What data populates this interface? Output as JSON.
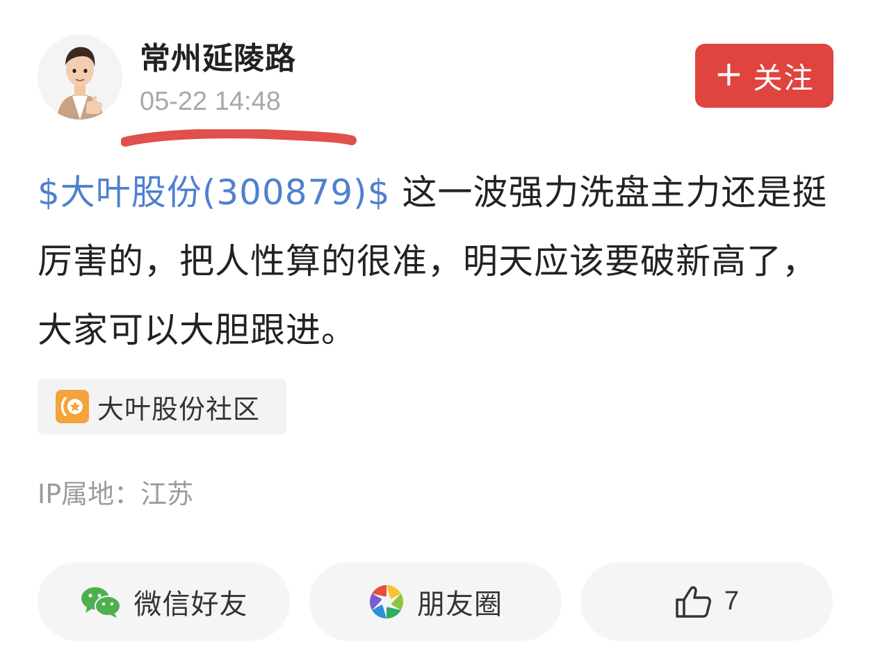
{
  "author": {
    "name": "常州延陵路",
    "timestamp": "05-22 14:48"
  },
  "follow_button": {
    "icon": "plus-icon",
    "label": "关注",
    "color": "#e0443f"
  },
  "post": {
    "stock_tag": "$大叶股份(300879)$",
    "text": " 这一波强力洗盘主力还是挺厉害的，把人性算的很准，明天应该要破新高了，大家可以大胆跟进。",
    "link_color": "#4f7fd1"
  },
  "community": {
    "icon": "community-home-icon",
    "label": "大叶股份社区",
    "icon_color": "#f5a33b"
  },
  "ip_location": "IP属地：江苏",
  "share_bar": {
    "wechat": {
      "icon": "wechat-icon",
      "label": "微信好友"
    },
    "moments": {
      "icon": "moments-icon",
      "label": "朋友圈"
    },
    "like": {
      "icon": "thumbs-up-icon",
      "count": "7"
    }
  },
  "annotation": {
    "color": "#e0504c"
  }
}
